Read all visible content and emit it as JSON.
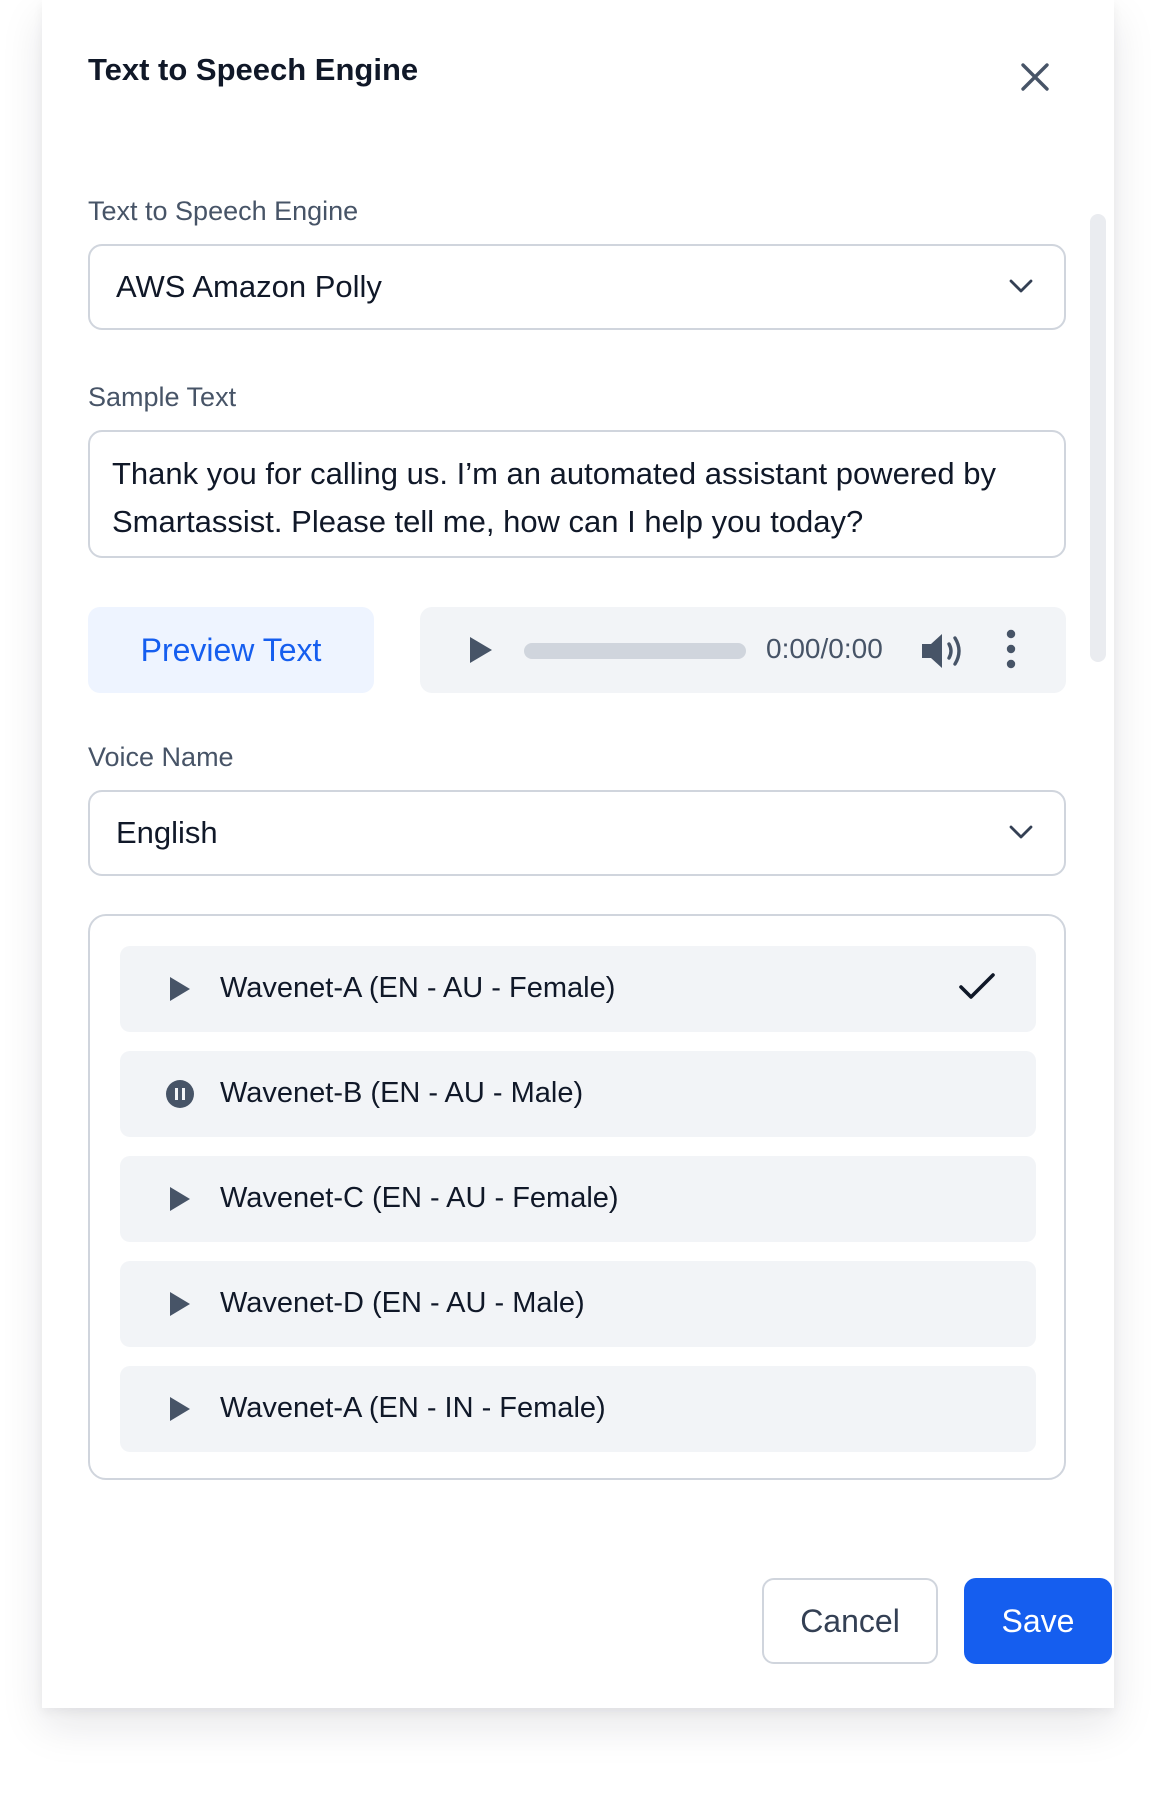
{
  "dialog": {
    "title": "Text to Speech Engine"
  },
  "engine": {
    "label": "Text to Speech Engine",
    "selected": "AWS Amazon Polly"
  },
  "sample": {
    "label": "Sample Text",
    "value": "Thank you for calling us. I’m an automated assistant powered by Smartassist. Please tell me, how can I help you today?"
  },
  "preview": {
    "button_label": "Preview Text"
  },
  "player": {
    "time": "0:00/0:00",
    "progress": 0
  },
  "voice": {
    "label": "Voice Name",
    "selected": "English"
  },
  "voices": [
    {
      "name": "Wavenet-A (EN - AU - Female)",
      "icon": "play-icon",
      "selected": true
    },
    {
      "name": "Wavenet-B (EN - AU - Male)",
      "icon": "pause-icon",
      "selected": false
    },
    {
      "name": "Wavenet-C (EN - AU - Female)",
      "icon": "play-icon",
      "selected": false
    },
    {
      "name": "Wavenet-D (EN - AU - Male)",
      "icon": "play-icon",
      "selected": false
    },
    {
      "name": "Wavenet-A (EN - IN - Female)",
      "icon": "play-icon",
      "selected": false
    }
  ],
  "footer": {
    "cancel_label": "Cancel",
    "save_label": "Save"
  },
  "colors": {
    "primary": "#155eef",
    "primary_light": "#eef4ff",
    "surface": "#f2f4f7",
    "border": "#d0d5dd",
    "text": "#101828",
    "muted": "#475467"
  }
}
